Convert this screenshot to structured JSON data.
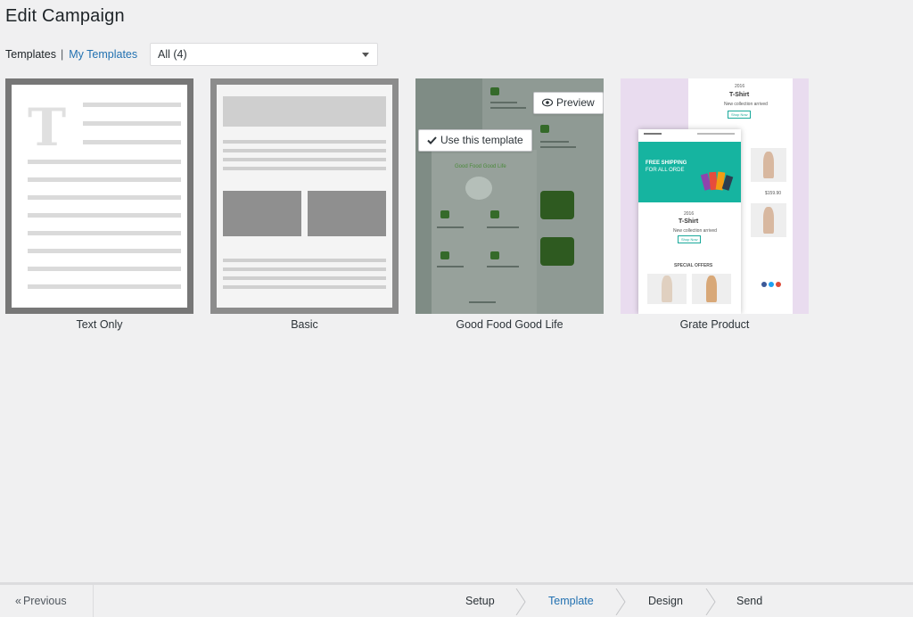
{
  "page": {
    "title": "Edit Campaign"
  },
  "filter": {
    "current_label": "Templates",
    "separator": "|",
    "my_templates_label": "My Templates",
    "select_value": "All (4)"
  },
  "templates": [
    {
      "label": "Text Only"
    },
    {
      "label": "Basic"
    },
    {
      "label": "Good Food Good Life",
      "preview_label": "Preview",
      "use_label": "Use this template",
      "thumb_heading": "Good Food Good Life"
    },
    {
      "label": "Grate Product",
      "thumb_year": "2016",
      "thumb_title": "T-Shirt",
      "thumb_sub": "New collection arrived",
      "thumb_shop": "Shop Now",
      "thumb_banner_1": "FREE SHIPPING",
      "thumb_banner_2": "FOR ALL ORDE",
      "thumb_special": "SPECIAL OFFERS",
      "thumb_price": "$159.90"
    }
  ],
  "wizard": {
    "previous_label": "Previous",
    "steps": [
      {
        "label": "Setup"
      },
      {
        "label": "Template",
        "active": true
      },
      {
        "label": "Design"
      },
      {
        "label": "Send"
      }
    ]
  },
  "colors": {
    "accent": "#2271b1",
    "teal": "#1aa99b"
  }
}
